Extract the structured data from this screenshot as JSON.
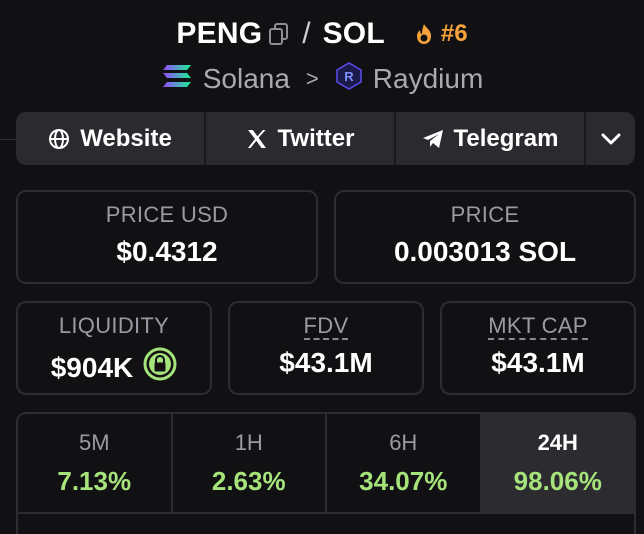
{
  "header": {
    "token": "PENG",
    "separator": "/",
    "quote": "SOL",
    "rank": "#6",
    "chain": "Solana",
    "chain_sep": ">",
    "dex": "Raydium"
  },
  "links": {
    "website": "Website",
    "twitter": "Twitter",
    "telegram": "Telegram"
  },
  "stats": {
    "price_usd_label": "PRICE USD",
    "price_usd_value": "$0.4312",
    "price_sol_label": "PRICE",
    "price_sol_value": "0.003013 SOL",
    "liquidity_label": "LIQUIDITY",
    "liquidity_value": "$904K",
    "fdv_label": "FDV",
    "fdv_value": "$43.1M",
    "mcap_label": "MKT CAP",
    "mcap_value": "$43.1M"
  },
  "timeframes": [
    {
      "label": "5M",
      "change": "7.13%"
    },
    {
      "label": "1H",
      "change": "2.63%"
    },
    {
      "label": "6H",
      "change": "34.07%"
    },
    {
      "label": "24H",
      "change": "98.06%"
    }
  ],
  "colors": {
    "background": "#111114",
    "positive": "#a6e37a",
    "rank_accent": "#f7a23b",
    "card_border": "#2c2c31",
    "lock_green": "#a6e37a"
  },
  "icons": {
    "copy": "copy-icon",
    "fire": "fire-icon",
    "solana": "solana-logo-icon",
    "raydium": "raydium-logo-icon",
    "globe": "globe-icon",
    "x": "x-logo-icon",
    "telegram": "telegram-icon",
    "chevron": "chevron-down-icon",
    "lock": "lock-icon"
  }
}
